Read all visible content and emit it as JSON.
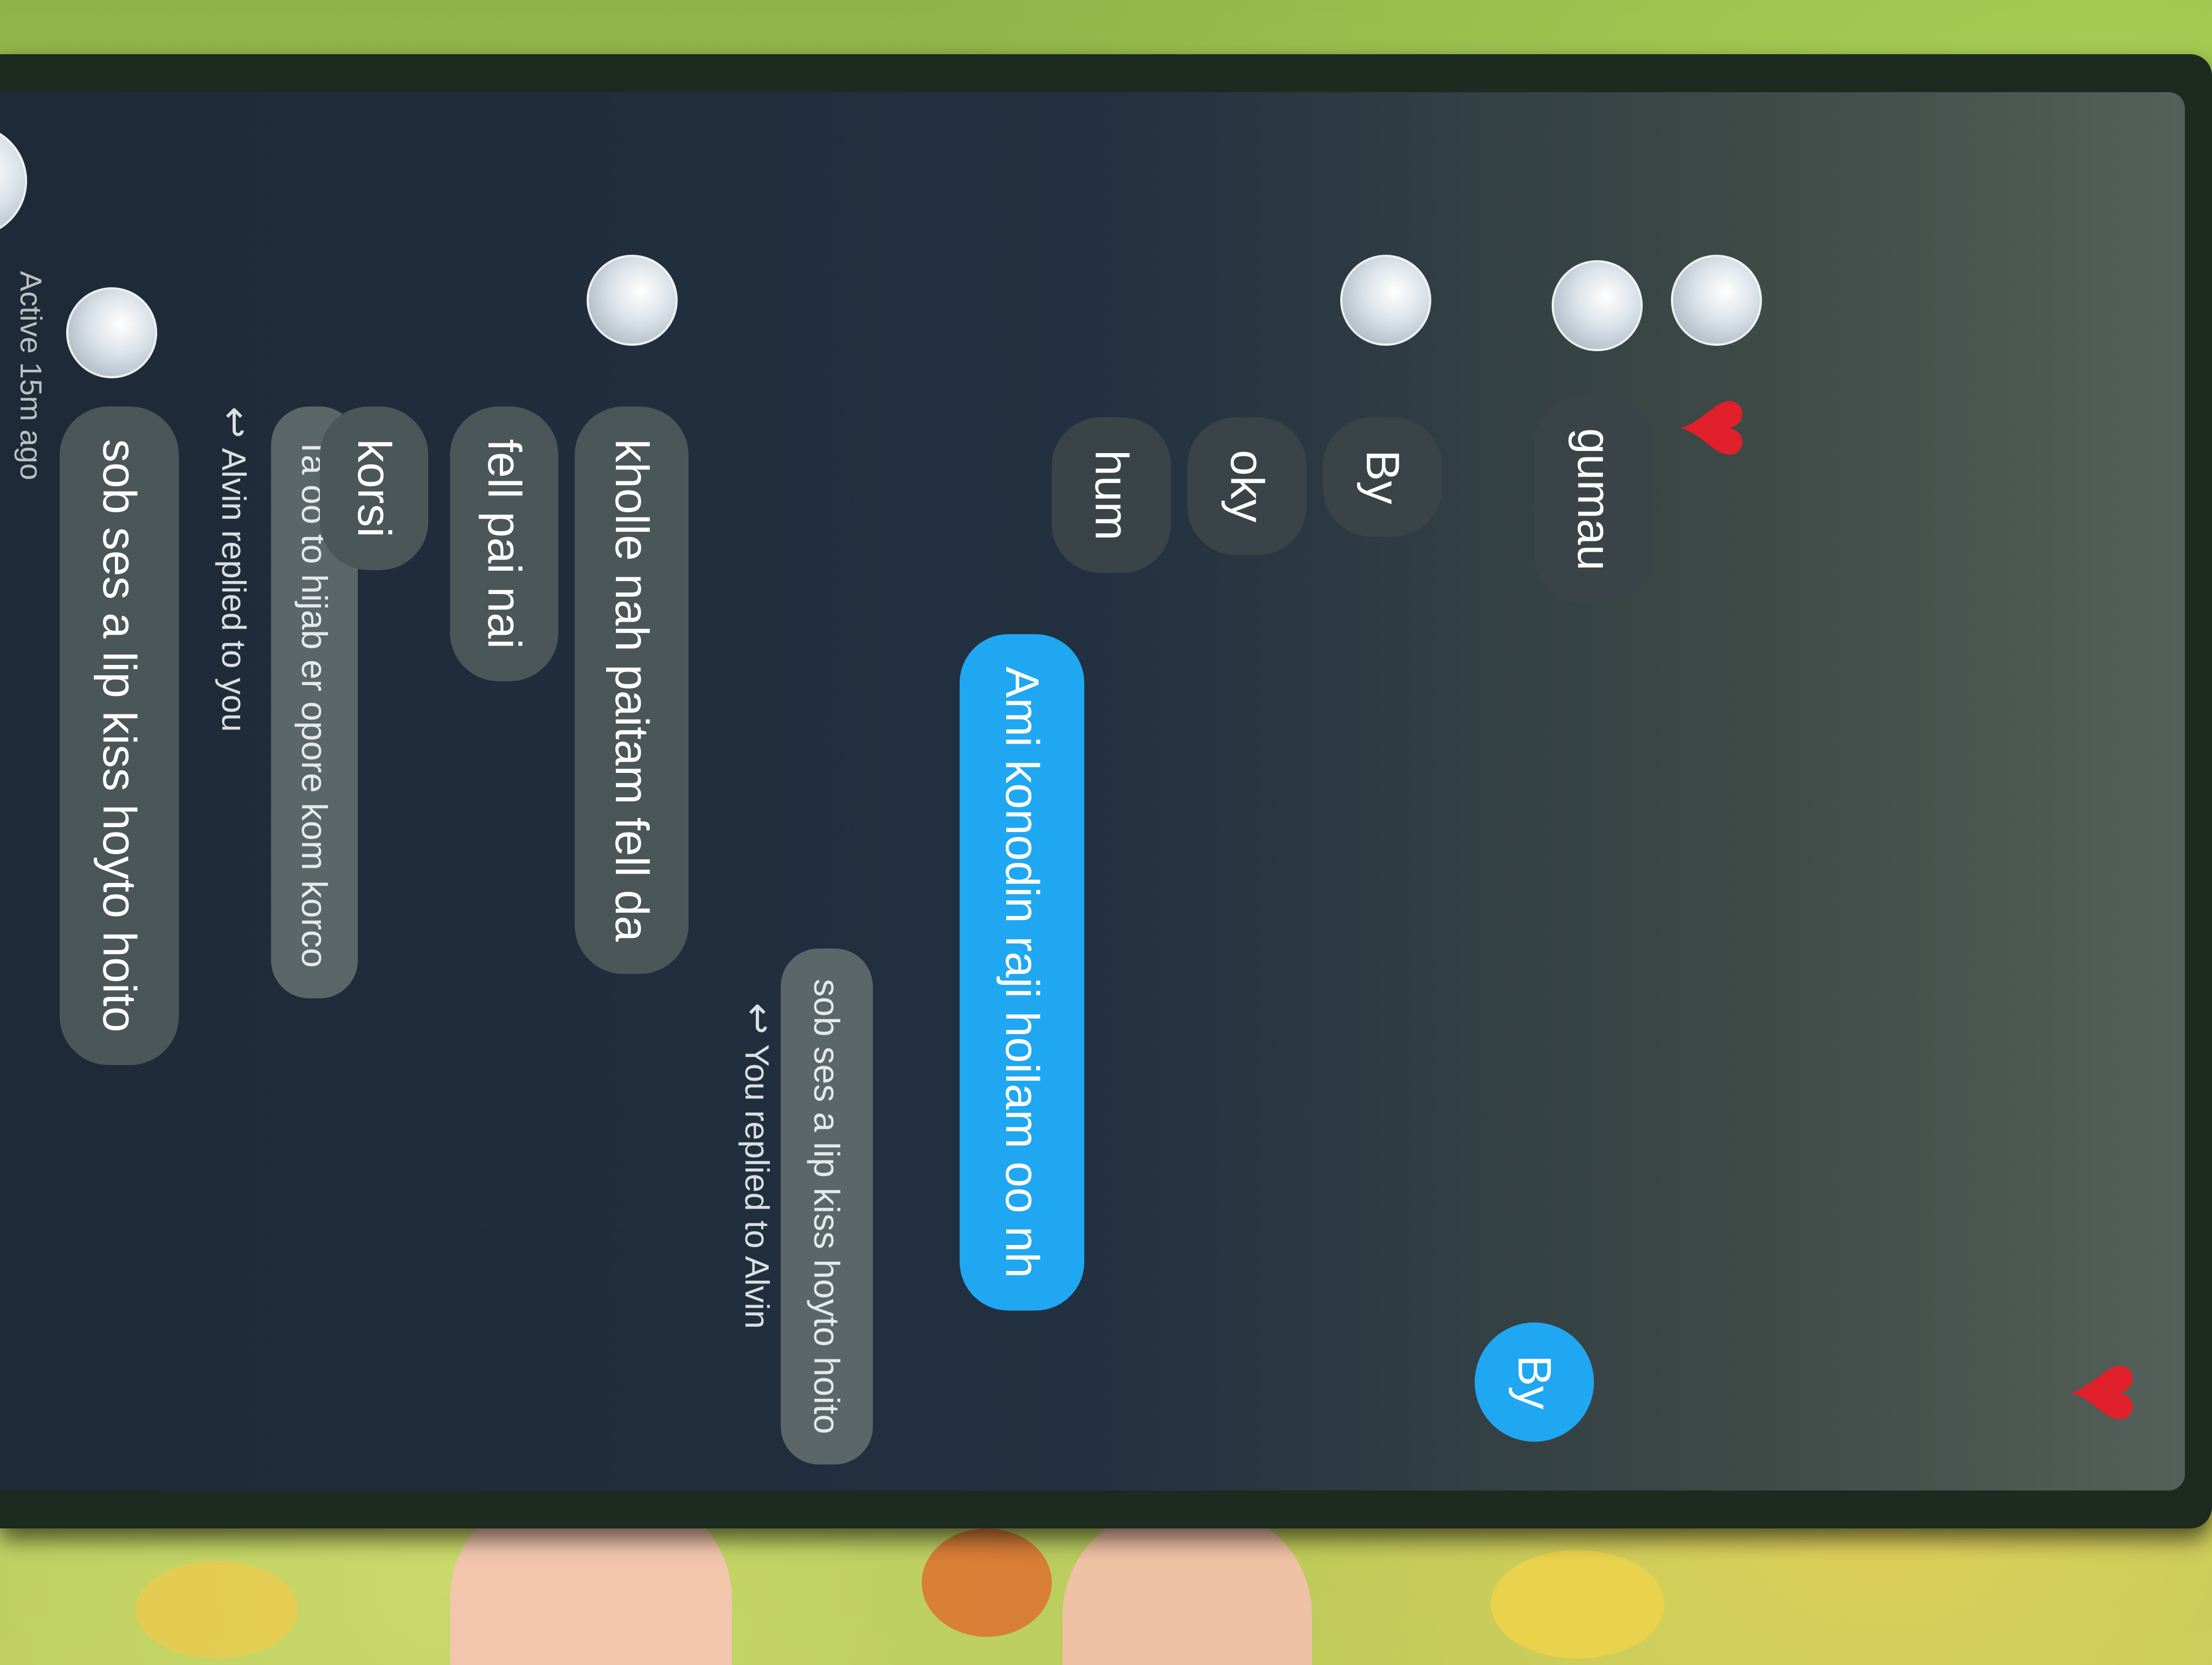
{
  "header": {
    "status": "Active 15m ago"
  },
  "messages": {
    "m1": "sob ses a lip kiss hoyto hoito",
    "m2_reply_label": "Alvin replied to you",
    "m2_quote": "Ta oo to hijab er opore kom korco",
    "m2": "korsi",
    "m3": "fell pai nai",
    "m4": "kholle nah paitam fell da",
    "m5_reply_label": "You replied to Alvin",
    "m5_quote": "sob ses a lip kiss hoyto hoito",
    "m5": "Ami konodin raji hoilam oo nh",
    "m6": "hum",
    "m7": "oky",
    "m8": "By",
    "m9_sent": "By",
    "m10": "gumau"
  },
  "icons": {
    "reply": "reply-arrow-icon",
    "heart": "heart-icon"
  },
  "colors": {
    "sent_bubble": "#1fa7f2",
    "received_bubble": "#4a5658",
    "heart": "#e0202a"
  }
}
